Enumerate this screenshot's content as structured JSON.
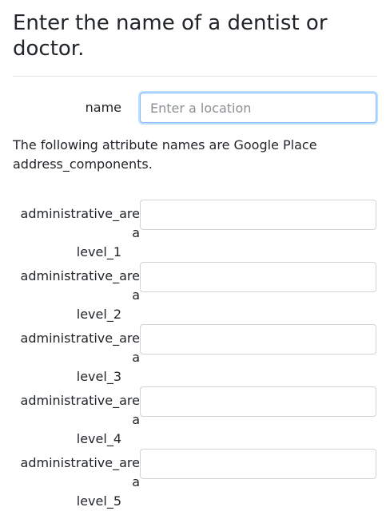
{
  "heading": "Enter the name of a dentist or doctor.",
  "name_field": {
    "label": "name",
    "placeholder": "Enter a location",
    "value": ""
  },
  "note": "The following attribute names are Google Place address_components.",
  "address_fields": [
    {
      "label_line1": "administrative_area",
      "label_line2": "level_1",
      "value": ""
    },
    {
      "label_line1": "administrative_area",
      "label_line2": "level_2",
      "value": ""
    },
    {
      "label_line1": "administrative_area",
      "label_line2": "level_3",
      "value": ""
    },
    {
      "label_line1": "administrative_area",
      "label_line2": "level_4",
      "value": ""
    },
    {
      "label_line1": "administrative_area",
      "label_line2": "level_5",
      "value": ""
    }
  ],
  "colors": {
    "focus_border": "#80bdff",
    "input_border": "#ced4da",
    "text": "#212529"
  }
}
